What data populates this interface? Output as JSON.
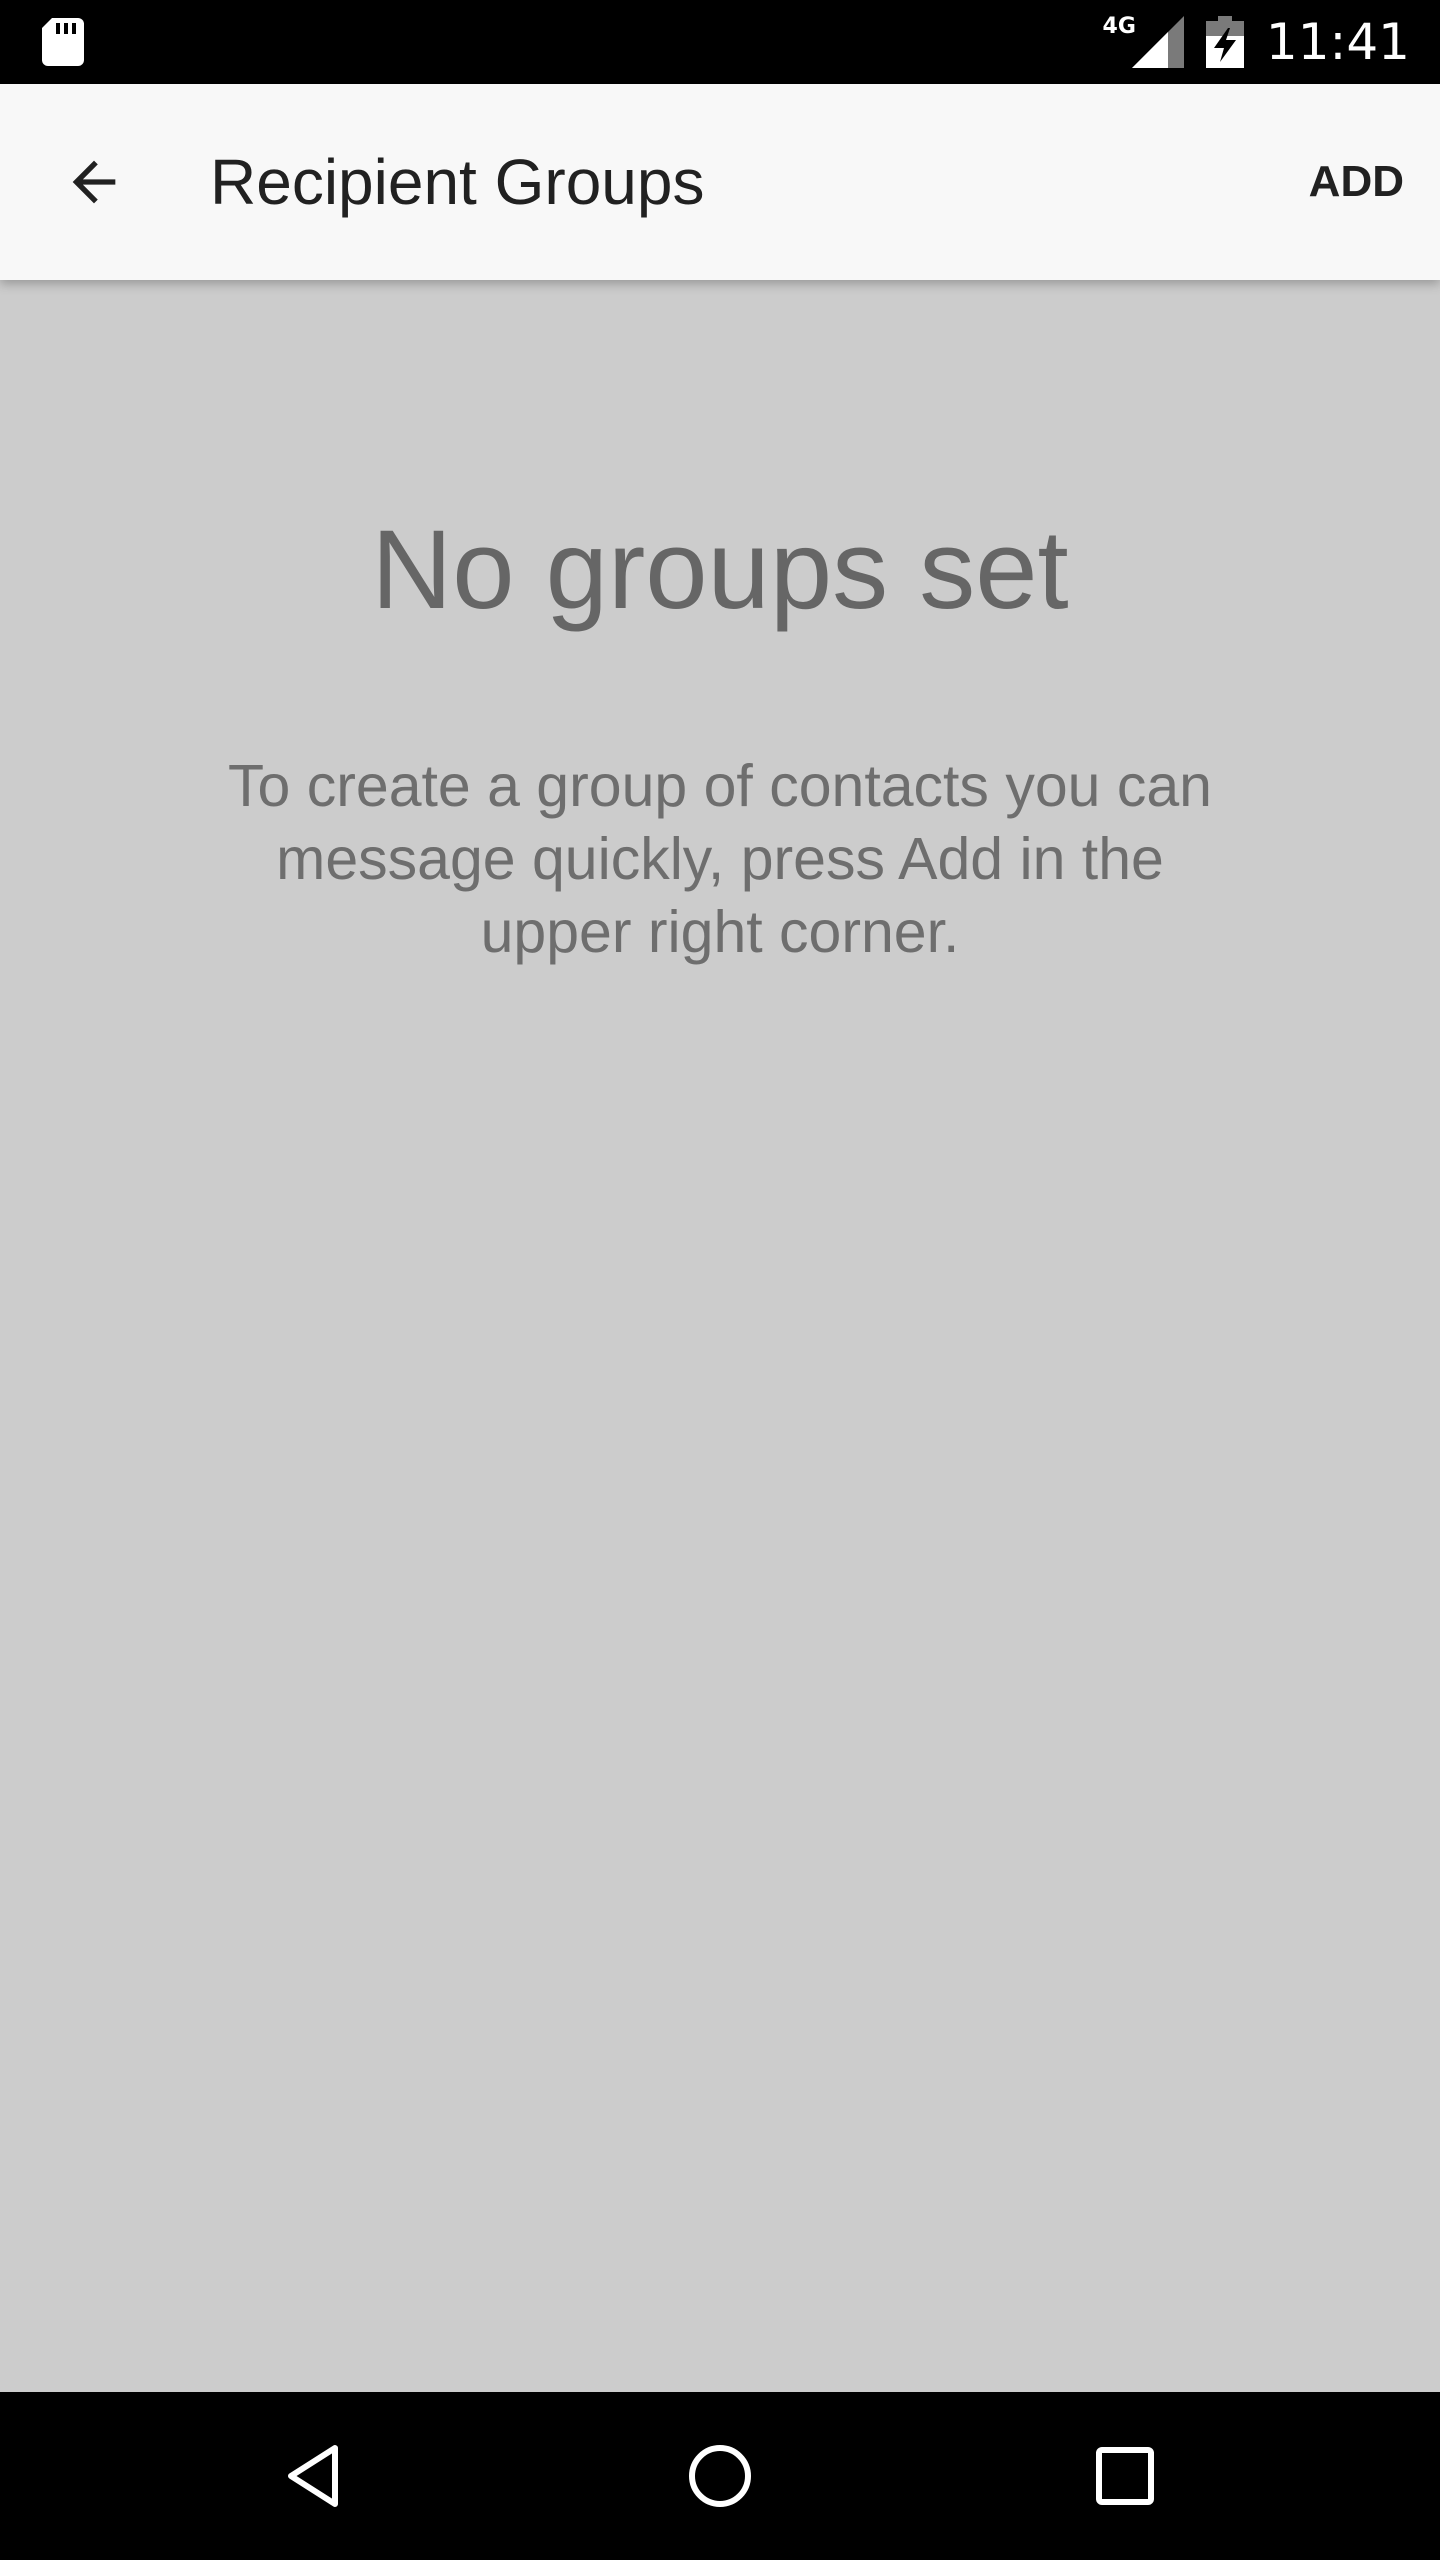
{
  "status_bar": {
    "time": "11:41",
    "network": "4G",
    "icons": [
      "sd-card-icon",
      "signal-icon",
      "battery-charging-icon"
    ]
  },
  "app_bar": {
    "back_icon": "arrow-back-icon",
    "title": "Recipient Groups",
    "action_label": "ADD"
  },
  "empty_state": {
    "title": "No groups set",
    "message": "To create a group of contacts you can message quickly, press Add in the upper right corner."
  },
  "nav_bar": {
    "icons": [
      "nav-back-icon",
      "nav-home-icon",
      "nav-recents-icon"
    ]
  },
  "colors": {
    "background": "#cccccc",
    "app_bar": "#f8f8f8",
    "system_bars": "#000000",
    "title_text": "#212121",
    "empty_text": "#666666"
  }
}
